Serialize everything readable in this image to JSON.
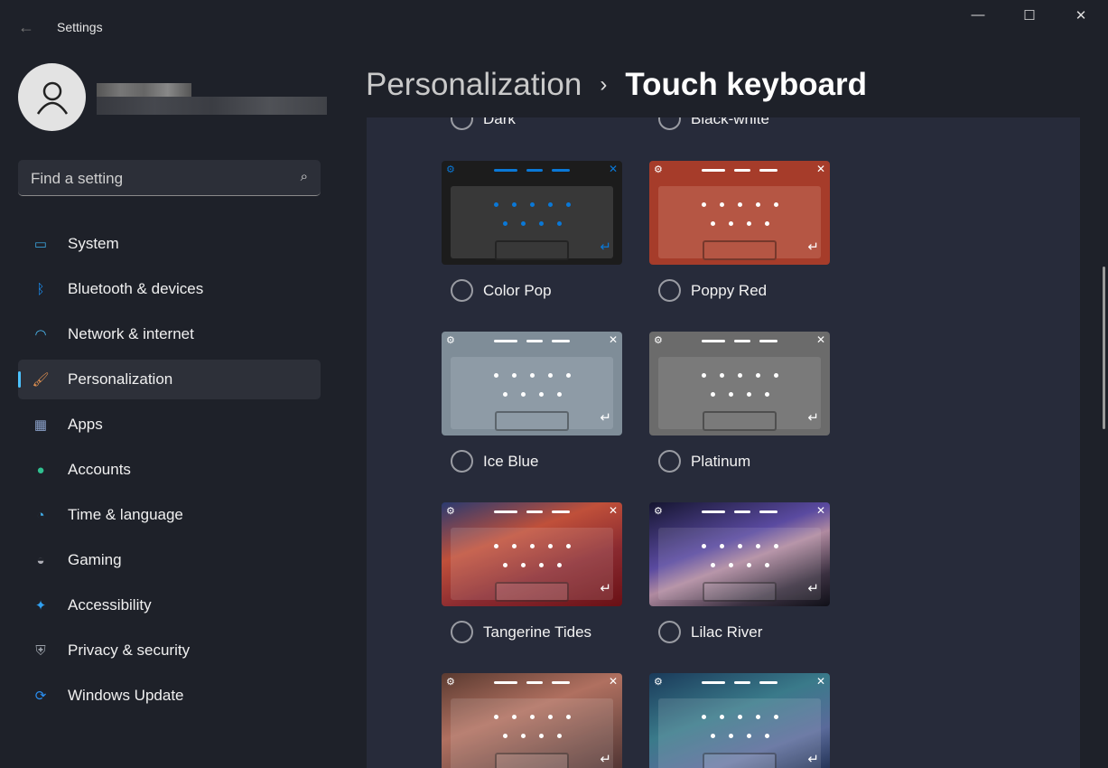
{
  "window": {
    "title": "Settings",
    "back_icon": "←",
    "minimize": "—",
    "maximize": "☐",
    "close": "✕"
  },
  "search": {
    "placeholder": "Find a setting",
    "icon": "⌕"
  },
  "nav": [
    {
      "label": "System",
      "icon": "▭",
      "color": "#3aa0d8"
    },
    {
      "label": "Bluetooth & devices",
      "icon": "ᛒ",
      "color": "#1a8cf0"
    },
    {
      "label": "Network & internet",
      "icon": "◠",
      "color": "#4cb8f0"
    },
    {
      "label": "Personalization",
      "icon": "🖌",
      "color": "#e09050",
      "selected": true
    },
    {
      "label": "Apps",
      "icon": "▦",
      "color": "#8aa0c8"
    },
    {
      "label": "Accounts",
      "icon": "●",
      "color": "#30c090"
    },
    {
      "label": "Time & language",
      "icon": "◔",
      "color": "#40a8e0"
    },
    {
      "label": "Gaming",
      "icon": "◒",
      "color": "#b0b0b8"
    },
    {
      "label": "Accessibility",
      "icon": "✦",
      "color": "#30a0f0"
    },
    {
      "label": "Privacy & security",
      "icon": "⛨",
      "color": "#9aa0a8"
    },
    {
      "label": "Windows Update",
      "icon": "⟳",
      "color": "#2a8ef0"
    }
  ],
  "breadcrumb": {
    "parent": "Personalization",
    "separator": "›",
    "current": "Touch keyboard"
  },
  "themes": [
    {
      "name": "Dark",
      "partial": true
    },
    {
      "name": "Black-white",
      "partial": true
    },
    {
      "name": "Color Pop",
      "bg": "#1c1c1c",
      "body": "#383838",
      "fg": "#0a78d7"
    },
    {
      "name": "Poppy Red",
      "bg": "#a63c2a",
      "body": "#b55644",
      "fg": "#ffffff"
    },
    {
      "name": "Ice Blue",
      "bg": "#7f8d98",
      "body": "#8e9ba6",
      "fg": "#ffffff"
    },
    {
      "name": "Platinum",
      "bg": "#6b6b6b",
      "body": "#7a7a7a",
      "fg": "#ffffff"
    },
    {
      "name": "Tangerine Tides",
      "bg": "linear-gradient(160deg,#2a3a70 0%,#c0503a 35%,#8a2a30 65%,#6a1015 100%)",
      "body": "rgba(255,255,255,.12)",
      "fg": "#ffffff"
    },
    {
      "name": "Lilac River",
      "bg": "linear-gradient(160deg,#151530 0%,#5a4aa0 40%,#b08aa0 55%,#3a3040 80%,#101018 100%)",
      "body": "rgba(255,255,255,.1)",
      "fg": "#ffffff"
    },
    {
      "name": "",
      "bg": "linear-gradient(160deg,#5a3a30 0%,#b07060 40%,#7a5048 70%,#4a3030 100%)",
      "body": "rgba(255,255,255,.12)",
      "fg": "#ffffff"
    },
    {
      "name": "",
      "bg": "linear-gradient(160deg,#1a3a5a 0%,#3a7a8a 40%,#5a6a9a 70%,#1a2a4a 100%)",
      "body": "rgba(255,255,255,.12)",
      "fg": "#ffffff"
    }
  ]
}
